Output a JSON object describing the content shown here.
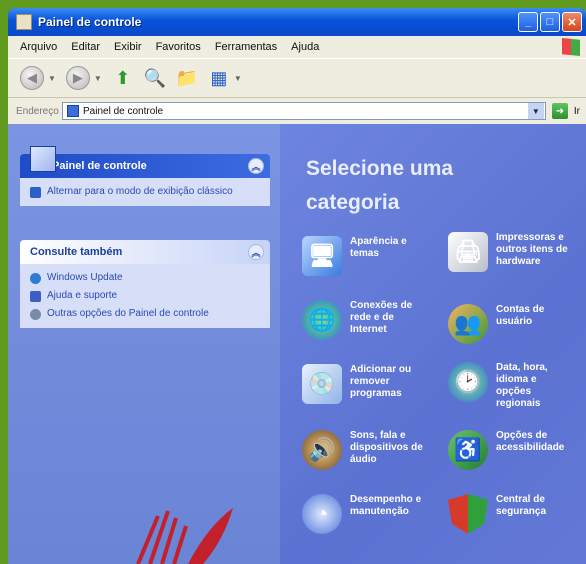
{
  "window": {
    "title": "Painel de controle"
  },
  "menu": [
    "Arquivo",
    "Editar",
    "Exibir",
    "Favoritos",
    "Ferramentas",
    "Ajuda"
  ],
  "address": {
    "label": "Endereço",
    "value": "Painel de controle",
    "go": "Ir"
  },
  "left_panel": {
    "title": "Painel de controle",
    "switch_view": "Alternar para o modo de exibição clássico"
  },
  "see_also": {
    "title": "Consulte também",
    "items": [
      "Windows Update",
      "Ajuda e suporte",
      "Outras opções do Painel de controle"
    ]
  },
  "main": {
    "heading": "Selecione uma categoria",
    "categories": [
      "Aparência e temas",
      "Impressoras e outros itens de hardware",
      "Conexões de rede e de Internet",
      "Contas de usuário",
      "Adicionar ou remover programas",
      "Data, hora, idioma e opções regionais",
      "Sons, fala e dispositivos de áudio",
      "Opções de acessibilidade",
      "Desempenho e manutenção",
      "Central de segurança"
    ]
  },
  "colors": {
    "titlebar": "#0752d8",
    "panel_head": "#1f4cc7",
    "content_bg": "#5d73cf",
    "desktop": "#5f9a1e"
  }
}
